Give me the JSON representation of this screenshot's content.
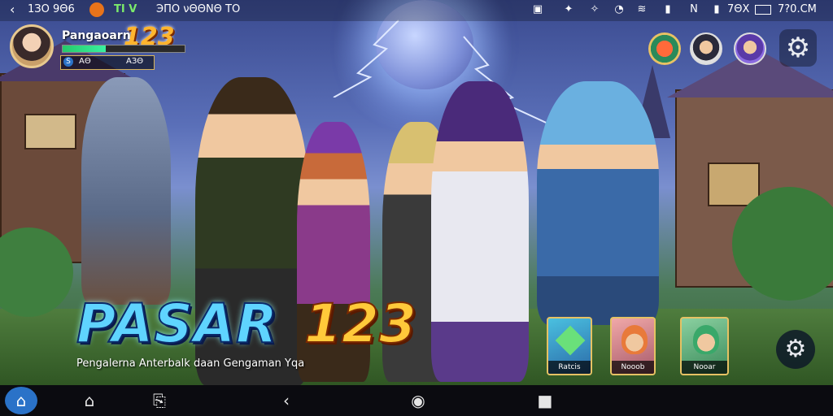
{
  "status_bar": {
    "left_time": "1ЗΟ 9Θ6",
    "app_badge": "ТІ V",
    "notice": "ЭΠΟ νΘΘΝΘ ΤΟ",
    "battery_text": "7ΘΧ",
    "right_time": "7?0.CM"
  },
  "profile": {
    "name": "Pangaoarn",
    "level_text": "123",
    "stat_icon": "S",
    "stat_left": "ΑΘ",
    "stat_right": "ΑЗΘ",
    "xp_progress": 0.35
  },
  "top_right": {
    "icons": [
      "badge-emblem-icon",
      "hero-avatar-1-icon",
      "hero-avatar-2-icon",
      "settings-gear-icon"
    ]
  },
  "logo": {
    "word": "PASAR",
    "number": "123",
    "tagline": "Pengalerna Anterbalk daan Gengaman Yqa"
  },
  "hero_cards": [
    {
      "label": "Ratcis",
      "color": "#2b6aa8"
    },
    {
      "label": "Nooob",
      "color": "#a85a6a"
    },
    {
      "label": "Nooar",
      "color": "#3a8a5a"
    }
  ],
  "nav_bar": {
    "items": [
      "home-icon",
      "house-outline-icon",
      "rotate-icon",
      "back-icon",
      "circle-home-icon",
      "square-recents-icon"
    ]
  }
}
